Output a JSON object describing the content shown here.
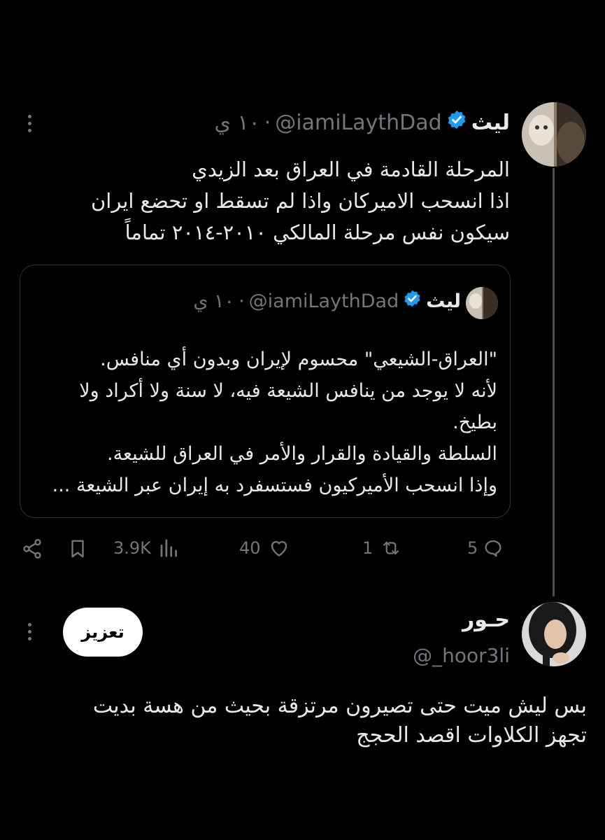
{
  "main_tweet": {
    "author_name": "ليث",
    "handle": "@iamiLaythDad",
    "separator": "·",
    "time": "١٠ ي",
    "text_lines": [
      "المرحلة القادمة في العراق بعد الزيدي",
      "اذا انسحب الاميركان واذا لم تسقط او تحضع ايران",
      "سيكون نفس مرحلة المالكي ٢٠١٠-٢٠١٤ تماماً"
    ]
  },
  "quoted_tweet": {
    "author_name": "ليث",
    "handle": "@iamiLaythDad",
    "separator": "·",
    "time": "١٠ ي",
    "text_lines": [
      "\"العراق-الشيعي\" محسوم لإيران وبدون أي منافس.",
      "لأنه لا يوجد من ينافس الشيعة فيه، لا سنة ولا أكراد ولا",
      "بطيخ.",
      "السلطة والقيادة والقرار والأمر في العراق للشيعة.",
      "وإذا انسحب الأميركيون فستسفرد به إيران عبر الشيعة ..."
    ]
  },
  "actions": {
    "views": "3.9K",
    "likes": "40",
    "reposts": "1",
    "replies": "5"
  },
  "reply_tweet": {
    "author_name": "حـور",
    "handle": "@_hoor3li",
    "boost_label": "تعزيز",
    "text_lines": [
      "بس ليش ميت حتى تصيرون مرتزقة بحيث من هسة بديت",
      "تجهز الكلاوات اقصد الحجج"
    ]
  },
  "colors": {
    "background": "#000000",
    "text": "#e7e9ea",
    "muted": "#71767b",
    "verified": "#1d9bf0",
    "border": "#2f3336"
  }
}
